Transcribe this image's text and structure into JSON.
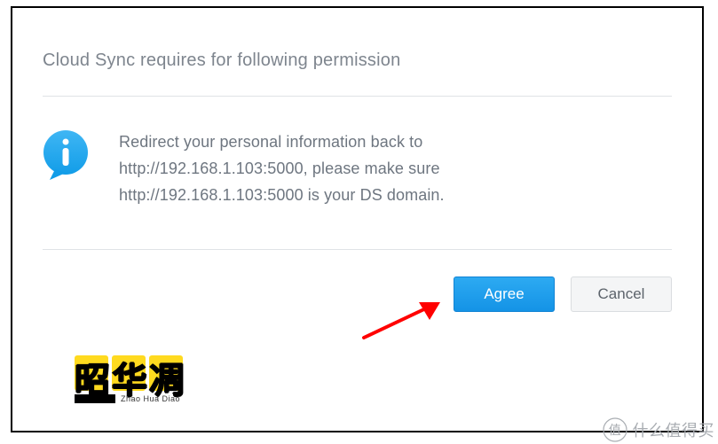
{
  "dialog": {
    "title": "Cloud Sync requires for following permission",
    "message": "Redirect your personal information back to http://192.168.1.103:5000, please make sure http://192.168.1.103:5000 is your DS domain.",
    "agree_label": "Agree",
    "cancel_label": "Cancel"
  },
  "icons": {
    "info": "info-icon"
  },
  "annotation": {
    "arrow_color": "#ff0000"
  },
  "logo": {
    "chinese": "昭华凋",
    "pinyin": "Zhao Hua Diao"
  },
  "footer": {
    "text": "什么值得买"
  }
}
